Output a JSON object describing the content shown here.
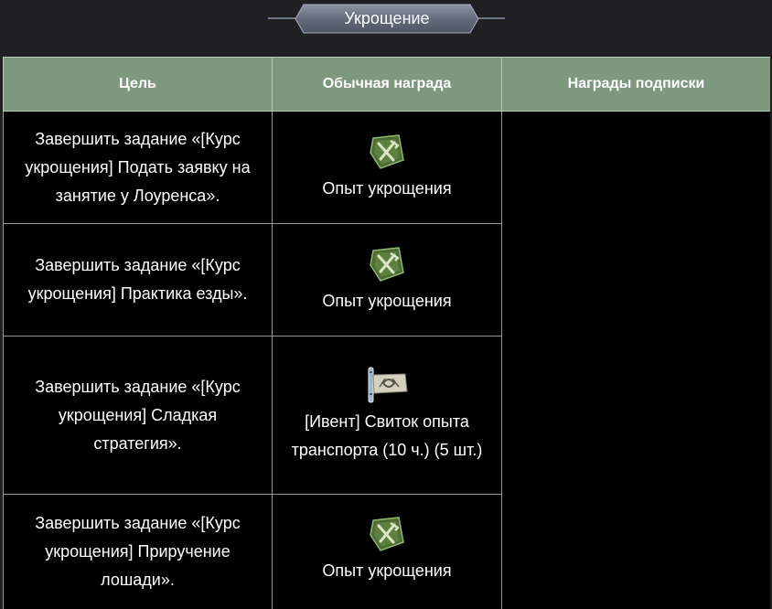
{
  "title": "Укрощение",
  "table": {
    "headers": {
      "goal": "Цель",
      "regular_reward": "Обычная награда",
      "subscription_reward": "Награды подписки"
    },
    "rows": [
      {
        "goal": "Завершить задание «[Курс укрощения] Подать заявку на занятие у Лоуренса».",
        "reward": "Опыт укрощения",
        "reward_icon": "taming-exp-icon"
      },
      {
        "goal": "Завершить задание «[Курс укрощения] Практика езды».",
        "reward": "Опыт укрощения",
        "reward_icon": "taming-exp-icon"
      },
      {
        "goal": "Завершить задание «[Курс укрощения] Сладкая стратегия».",
        "reward": "[Ивент] Свиток опыта транспорта (10 ч.) (5 шт.)",
        "reward_icon": "scroll-icon"
      },
      {
        "goal": "Завершить задание «[Курс укрощения] Приручение лошади».",
        "reward": "Опыт укрощения",
        "reward_icon": "taming-exp-icon"
      }
    ]
  },
  "colors": {
    "background": "#202022",
    "header_bg": "#7e9880",
    "cell_bg": "#000000",
    "title_plate": "#6c7484"
  }
}
